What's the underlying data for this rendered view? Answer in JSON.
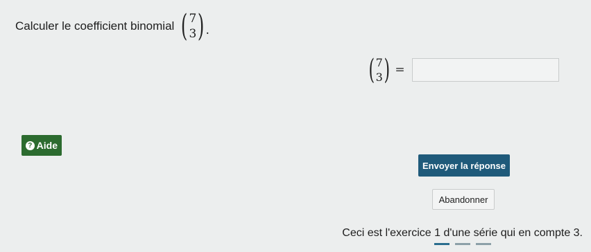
{
  "question": {
    "text": "Calculer le coefficient binomial",
    "binom_n": "7",
    "binom_k": "3",
    "end_punct": "."
  },
  "answer": {
    "binom_n": "7",
    "binom_k": "3",
    "equals": "=",
    "value": ""
  },
  "buttons": {
    "help_icon": "?",
    "help_label": "Aide",
    "submit_label": "Envoyer la réponse",
    "abandon_label": "Abandonner"
  },
  "footer": {
    "note": "Ceci est l'exercice 1 d'une série qui en compte 3."
  },
  "colors": {
    "help_button": "#2c6b2f",
    "submit_button": "#1f5a7a",
    "background": "#eceeee"
  },
  "icons": {
    "help": "question-circle-icon"
  }
}
